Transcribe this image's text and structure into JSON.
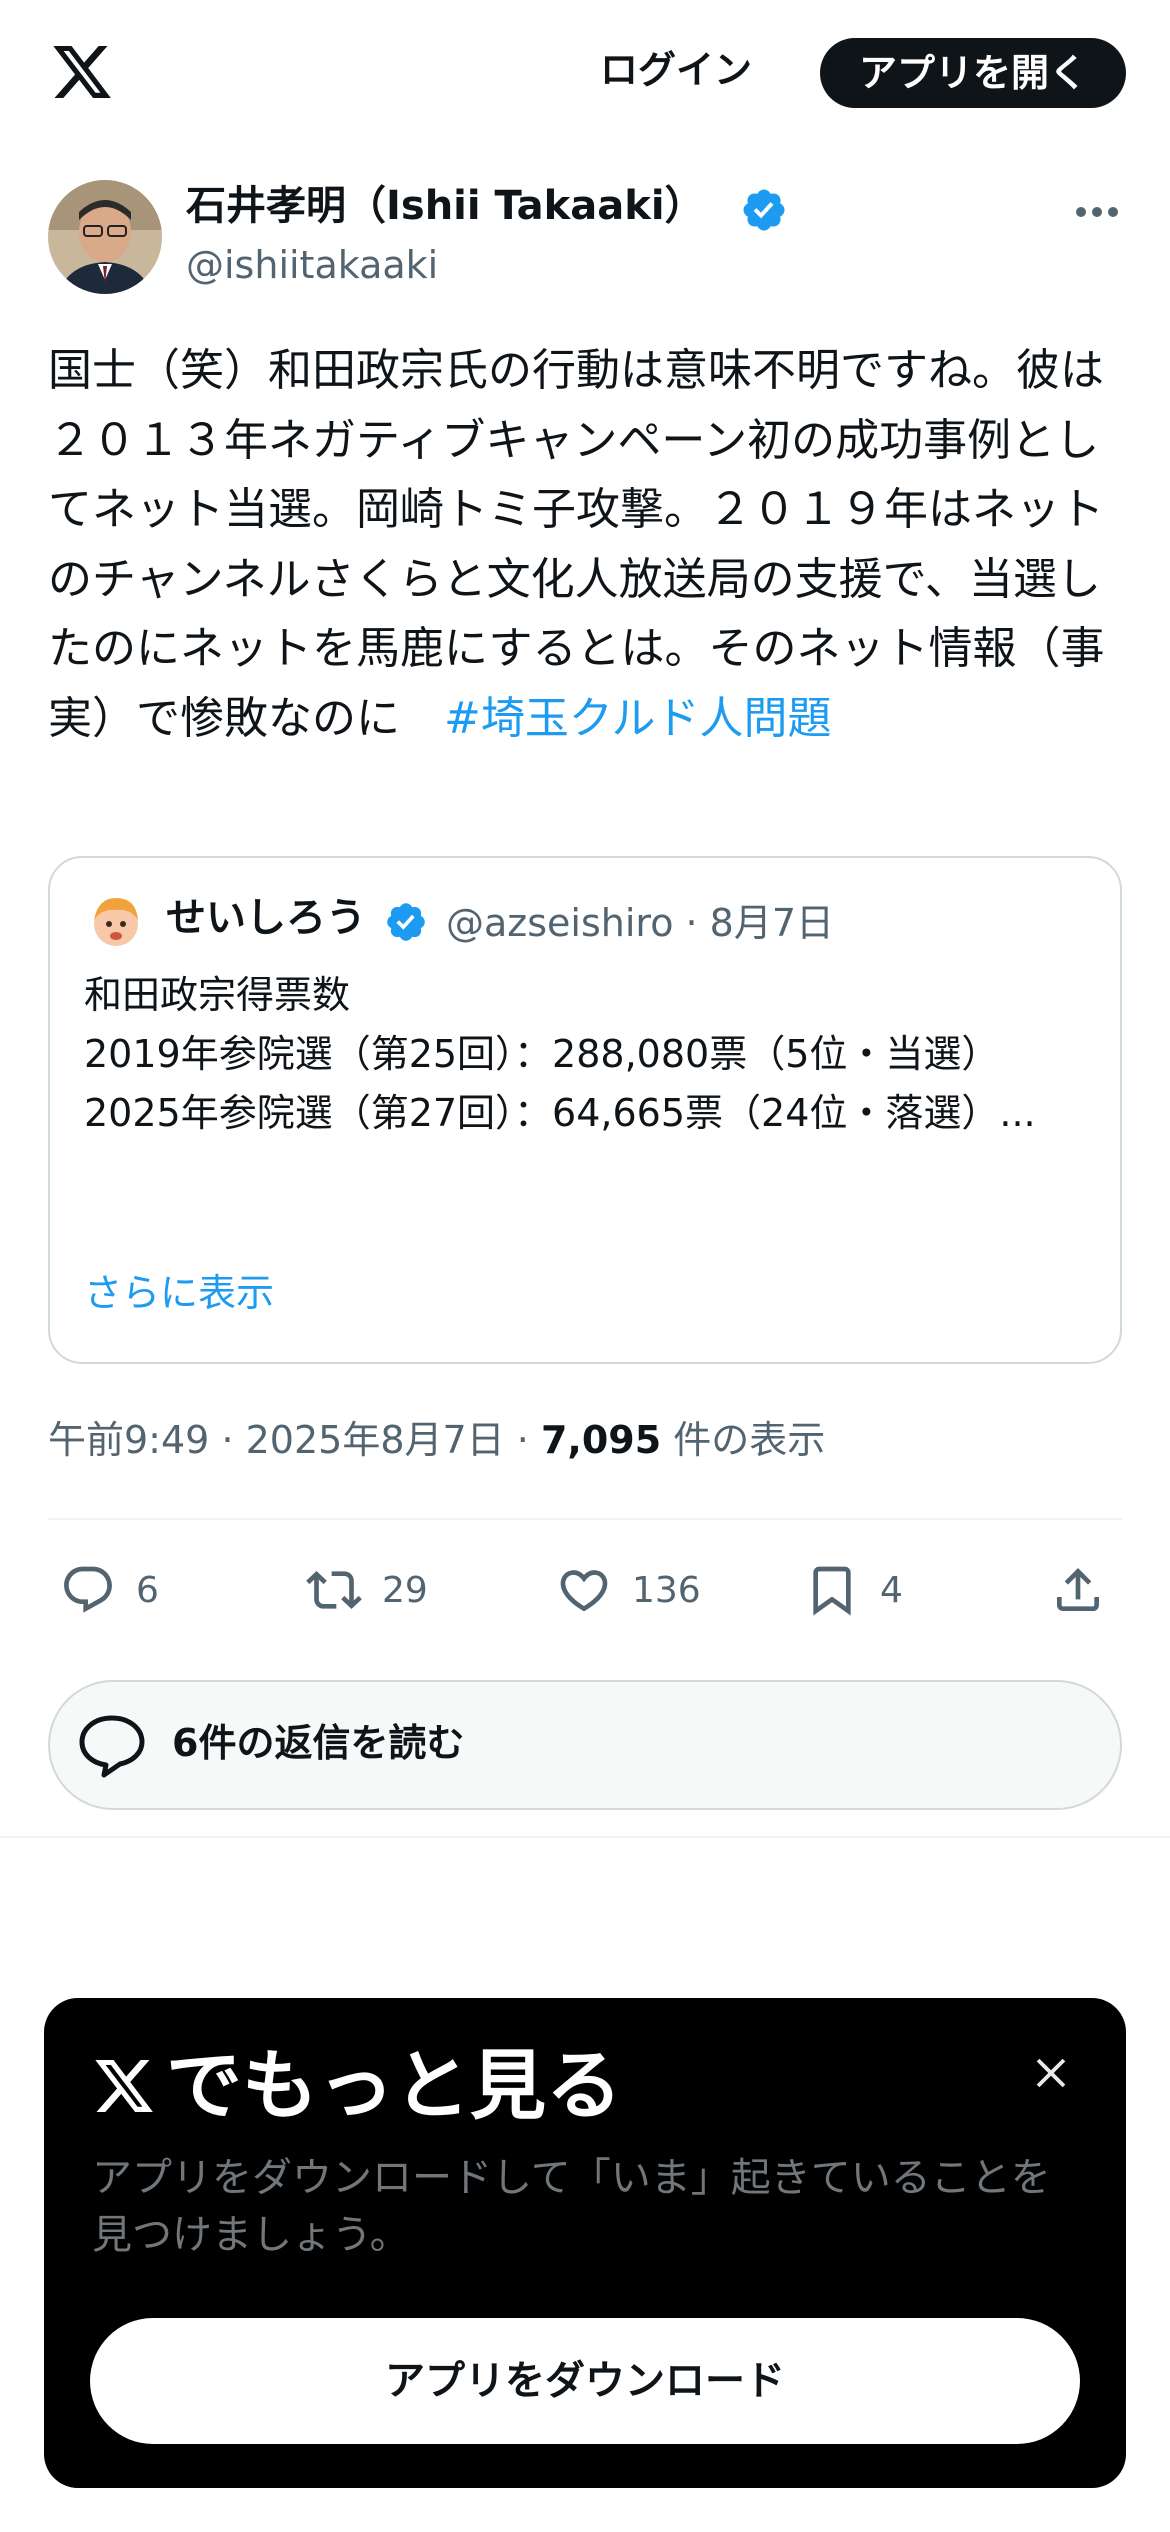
{
  "header": {
    "login_label": "ログイン",
    "open_app_label": "アプリを開く"
  },
  "tweet": {
    "author_name": "石井孝明（Ishii Takaaki）",
    "handle": "@ishiitakaaki",
    "text": "国士（笑）和田政宗氏の行動は意味不明ですね。彼は２０１３年ネガティブキャンペーン初の成功事例としてネット当選。岡崎トミ子攻撃。２０１９年はネットのチャンネルさくらと文化人放送局の支援で、当選したのにネットを馬鹿にするとは。そのネット情報（事実）で惨敗なのに　",
    "hashtag": "#埼玉クルド人問題",
    "time": "午前9:49",
    "date": "2025年8月7日",
    "views_count": "7,095",
    "views_label": "件の表示",
    "separator": "·"
  },
  "quote": {
    "author_name": "せいしろう",
    "meta": "@azseishiro · 8月7日",
    "text": "和田政宗得票数\n2019年参院選（第25回）：288,080票（5位・当選）\n2025年参院選（第27回）：64,665票（24位・落選）...",
    "show_more_label": "さらに表示"
  },
  "actions": {
    "replies": "6",
    "retweets": "29",
    "likes": "136",
    "bookmarks": "4"
  },
  "read_replies_label": "6件の返信を読む",
  "sheet": {
    "title_suffix": "でもっと見る",
    "description": "アプリをダウンロードして「いま」起きていることを見つけましょう。",
    "download_label": "アプリをダウンロード"
  },
  "colors": {
    "accent": "#1d9bf0",
    "text": "#0f1419",
    "muted": "#536471",
    "border": "#cfd9de"
  }
}
